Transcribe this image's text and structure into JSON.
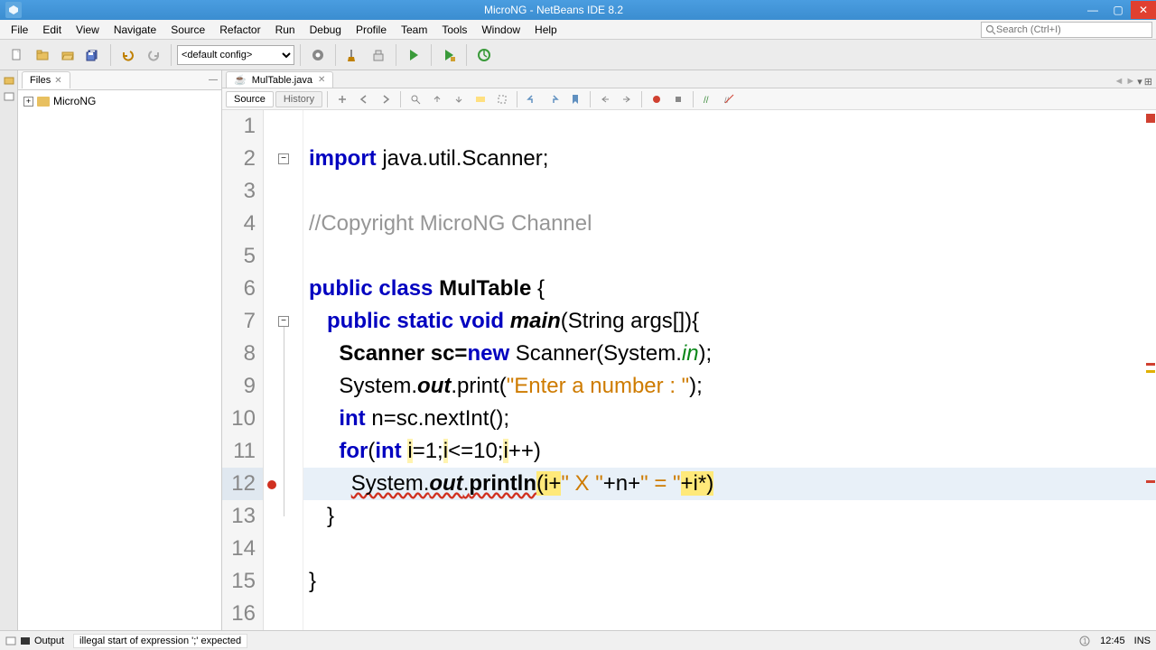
{
  "window": {
    "title": "MicroNG - NetBeans IDE 8.2"
  },
  "menu": {
    "items": [
      "File",
      "Edit",
      "View",
      "Navigate",
      "Source",
      "Refactor",
      "Run",
      "Debug",
      "Profile",
      "Team",
      "Tools",
      "Window",
      "Help"
    ],
    "search_placeholder": "Search (Ctrl+I)"
  },
  "toolbar": {
    "config": "<default config>"
  },
  "files_pane": {
    "tab": "Files",
    "project": "MicroNG"
  },
  "editor": {
    "tab_name": "MulTable.java",
    "view_source": "Source",
    "view_history": "History",
    "lines": {
      "l1": "",
      "l2_kw": "import",
      "l2_rest": " java.util.Scanner;",
      "l3": "",
      "l4": "//Copyright MicroNG Channel",
      "l5": "",
      "l6_kw1": "public",
      "l6_kw2": "class",
      "l6_cls": "MulTable",
      "l6_rest": " {",
      "l7_kw1": "public",
      "l7_kw2": "static",
      "l7_kw3": "void",
      "l7_m": "main",
      "l7_rest": "(String args[]){",
      "l8_a": "Scanner sc=",
      "l8_new": "new",
      "l8_b": " Scanner(System.",
      "l8_in": "in",
      "l8_c": ");",
      "l9_a": "System.",
      "l9_out": "out",
      "l9_b": ".print(",
      "l9_s": "\"Enter a number : \"",
      "l9_c": ");",
      "l10_kw": "int",
      "l10_rest": " n=sc.nextInt();",
      "l11_for": "for",
      "l11_a": "(",
      "l11_int": "int",
      "l11_b": " ",
      "l11_i1": "i",
      "l11_c": "=1;",
      "l11_i2": "i",
      "l11_d": "<=10;",
      "l11_i3": "i",
      "l11_e": "++)",
      "l12_a": "System.",
      "l12_out": "out",
      "l12_b": ".",
      "l12_pl": "println",
      "l12_p1": "(i+",
      "l12_s1": "\" X \"",
      "l12_p2": "+n+",
      "l12_s2": "\" = \"",
      "l12_p3": "+i*)",
      "l13": "}",
      "l14": "",
      "l15": "}",
      "l16": ""
    }
  },
  "status": {
    "output": "Output",
    "error": "illegal start of expression ';' expected",
    "line_col": "12:45",
    "ins": "INS"
  }
}
